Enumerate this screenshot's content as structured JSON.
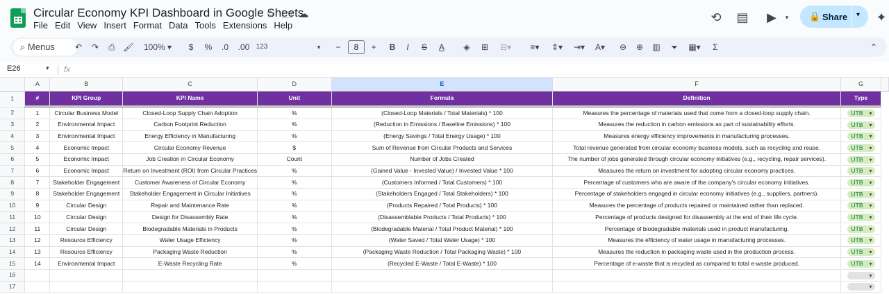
{
  "app": {
    "doc_title": "Circular Economy KPI Dashboard in Google Sheets",
    "menu": [
      "File",
      "Edit",
      "View",
      "Insert",
      "Format",
      "Data",
      "Tools",
      "Extensions",
      "Help"
    ],
    "share_label": "Share"
  },
  "toolbar": {
    "search_label": "Menus",
    "zoom": "100%",
    "currency": "$",
    "percent": "%",
    "dec_decrease": ".0",
    "dec_increase": ".00",
    "number_format": "123",
    "font_size": "8",
    "minus": "−",
    "plus": "+",
    "bold": "B",
    "sum": "Σ"
  },
  "formula_bar": {
    "cell_ref": "E26",
    "fx": "fx"
  },
  "columns": [
    "A",
    "B",
    "C",
    "D",
    "E",
    "F",
    "G"
  ],
  "header_row": {
    "row_num": "1",
    "cells": [
      "#",
      "KPI Group",
      "KPI Name",
      "Unit",
      "Formula",
      "Definition",
      "Type"
    ]
  },
  "rows": [
    {
      "n": "2",
      "cells": [
        "1",
        "Circular Business Model",
        "Closed-Loop Supply Chain Adoption",
        "%",
        "(Closed-Loop Materials / Total Materials) * 100",
        "Measures the percentage of materials used that come from a closed-loop supply chain.",
        "UTB"
      ]
    },
    {
      "n": "3",
      "cells": [
        "2",
        "Environmental Impact",
        "Carbon Footprint Reduction",
        "%",
        "(Reduction in Emissions / Baseline Emissions) * 100",
        "Measures the reduction in carbon emissions as part of sustainability efforts.",
        "UTB"
      ]
    },
    {
      "n": "4",
      "cells": [
        "3",
        "Environmental Impact",
        "Energy Efficiency in Manufacturing",
        "%",
        "(Energy Savings / Total Energy Usage) * 100",
        "Measures energy efficiency improvements in manufacturing processes.",
        "UTB"
      ]
    },
    {
      "n": "5",
      "cells": [
        "4",
        "Economic Impact",
        "Circular Economy Revenue",
        "$",
        "Sum of Revenue from Circular Products and Services",
        "Total revenue generated from circular economy business models, such as recycling and reuse.",
        "UTB"
      ]
    },
    {
      "n": "6",
      "cells": [
        "5",
        "Economic Impact",
        "Job Creation in Circular Economy",
        "Count",
        "Number of Jobs Created",
        "The number of jobs generated through circular economy initiatives (e.g., recycling, repair services).",
        "UTB"
      ]
    },
    {
      "n": "7",
      "cells": [
        "6",
        "Economic Impact",
        "Return on Investment (ROI) from Circular Practices",
        "%",
        "(Gained Value - Invested Value) / Invested Value * 100",
        "Measures the return on investment for adopting circular economy practices.",
        "UTB"
      ]
    },
    {
      "n": "8",
      "cells": [
        "7",
        "Stakeholder Engagement",
        "Customer Awareness of Circular Economy",
        "%",
        "(Customers Informed / Total Customers) * 100",
        "Percentage of customers who are aware of the company's circular economy initiatives.",
        "UTB"
      ]
    },
    {
      "n": "9",
      "cells": [
        "8",
        "Stakeholder Engagement",
        "Stakeholder Engagement in Circular Initiatives",
        "%",
        "(Stakeholders Engaged / Total Stakeholders) * 100",
        "Percentage of stakeholders engaged in circular economy initiatives (e.g., suppliers, partners).",
        "UTB"
      ]
    },
    {
      "n": "10",
      "cells": [
        "9",
        "Circular Design",
        "Repair and Maintenance Rate",
        "%",
        "(Products Repaired / Total Products) * 100",
        "Measures the percentage of products repaired or maintained rather than replaced.",
        "UTB"
      ]
    },
    {
      "n": "11",
      "cells": [
        "10",
        "Circular Design",
        "Design for Disassembly Rate",
        "%",
        "(Disassemblable Products / Total Products) * 100",
        "Percentage of products designed for disassembly at the end of their life cycle.",
        "UTB"
      ]
    },
    {
      "n": "12",
      "cells": [
        "11",
        "Circular Design",
        "Biodegradable Materials in Products",
        "%",
        "(Biodegradable Material / Total Product Material) * 100",
        "Percentage of biodegradable materials used in product manufacturing.",
        "UTB"
      ]
    },
    {
      "n": "13",
      "cells": [
        "12",
        "Resource Efficiency",
        "Water Usage Efficiency",
        "%",
        "(Water Saved / Total Water Usage) * 100",
        "Measures the efficiency of water usage in manufacturing processes.",
        "UTB"
      ]
    },
    {
      "n": "14",
      "cells": [
        "13",
        "Resource Efficiency",
        "Packaging Waste Reduction",
        "%",
        "(Packaging Waste Reduction / Total Packaging Waste) * 100",
        "Measures the reduction in packaging waste used in the production process.",
        "UTB"
      ]
    },
    {
      "n": "15",
      "cells": [
        "14",
        "Environmental Impact",
        "E-Waste Recycling Rate",
        "%",
        "(Recycled E-Waste / Total E-Waste) * 100",
        "Percentage of e-waste that is recycled as compared to total e-waste produced.",
        "UTB"
      ]
    },
    {
      "n": "16",
      "cells": [
        "",
        "",
        "",
        "",
        "",
        "",
        ""
      ]
    },
    {
      "n": "17",
      "cells": [
        "",
        "",
        "",
        "",
        "",
        "",
        ""
      ]
    }
  ]
}
